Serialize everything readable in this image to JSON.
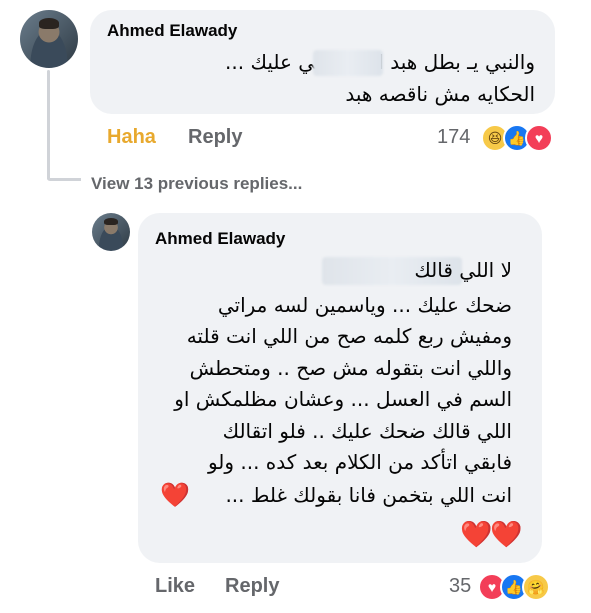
{
  "comment1": {
    "author": "Ahmed Elawady",
    "line1": "والنبي يـ          بطل هبد  الله يرضي عليك ...",
    "line2": "الحكايه مش ناقصه هبد",
    "actions": {
      "haha": "Haha",
      "reply": "Reply"
    },
    "reaction_count": "174",
    "reactions": [
      "haha-icon",
      "like-icon",
      "love-icon"
    ]
  },
  "view_previous": "View 13 previous replies...",
  "comment2": {
    "author": "Ahmed Elawady",
    "lines": [
      "لا اللي قالك",
      "ضحك عليك ... وياسمين لسه مراتي",
      "ومفيش ربع كلمه صح من اللي انت قلته",
      "واللي انت بتقوله مش صح .. ومتحطش",
      "السم في العسل ... وعشان مظلمكش او",
      "اللي قالك ضحك عليك .. فلو اتقالك",
      "فابقي اتأكد من الكلام بعد كده ... ولو",
      "انت اللي بتخمن فانا بقولك غلط ..."
    ],
    "heart_one": "❤️",
    "hearts_two": "❤️❤️",
    "actions": {
      "like": "Like",
      "reply": "Reply"
    },
    "reaction_count": "35",
    "reactions": [
      "love-icon",
      "like-icon",
      "care-icon"
    ]
  },
  "colors": {
    "bubble": "#f0f2f5",
    "muted": "#65676b",
    "haha_active": "#e8a92e",
    "like": "#1877f2",
    "love": "#f33e58"
  }
}
